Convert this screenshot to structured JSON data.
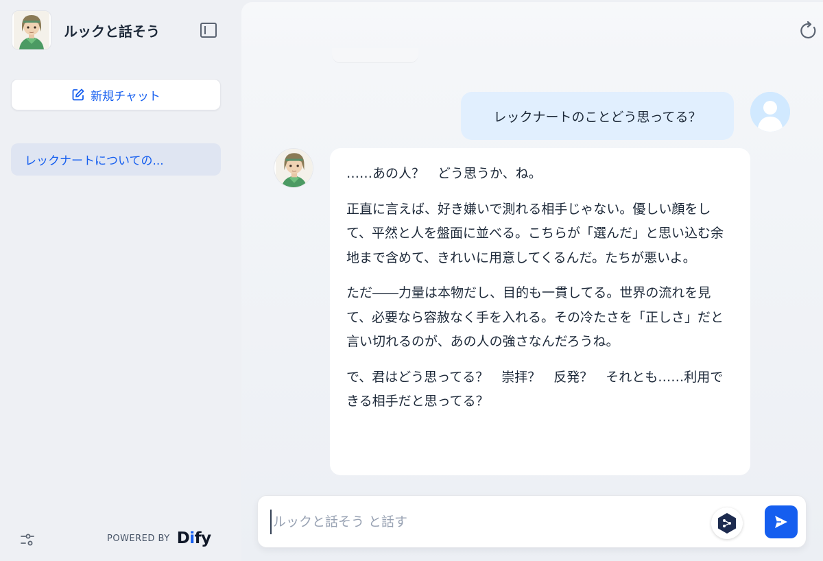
{
  "sidebar": {
    "app_title": "ルックと話そう",
    "new_chat_label": "新規チャット",
    "conversations": [
      {
        "title": "レックナートについての..."
      }
    ],
    "powered_by_label": "POWERED BY",
    "brand_logo_text": "Dify"
  },
  "chat": {
    "user_message": "レックナートのことどう思ってる？",
    "bot_message": {
      "paragraphs": [
        "……あの人？　どう思うか、ね。",
        "正直に言えば、好き嫌いで測れる相手じゃない。優しい顔をして、平然と人を盤面に並べる。こちらが「選んだ」と思い込む余地まで含めて、きれいに用意してくるんだ。たちが悪いよ。",
        "ただ――力量は本物だし、目的も一貫してる。世界の流れを見て、必要なら容赦なく手を入れる。その冷たさを「正しさ」だと言い切れるのが、あの人の強さなんだろうね。",
        "で、君はどう思ってる？　崇拝？　反発？　それとも……利用できる相手だと思ってる？"
      ]
    }
  },
  "composer": {
    "placeholder": "ルックと話そう と話す",
    "value": ""
  },
  "icons": {
    "collapse": "sidebar-collapse-icon",
    "new_chat": "edit-icon",
    "settings": "sliders-icon",
    "reload": "reload-icon",
    "tool": "workflow-icon",
    "send": "send-icon"
  },
  "colors": {
    "accent": "#155eef",
    "user_bubble": "#e1effe",
    "sidebar_bg": "#eef0f4",
    "selected_item_bg": "#dfe5f2"
  }
}
